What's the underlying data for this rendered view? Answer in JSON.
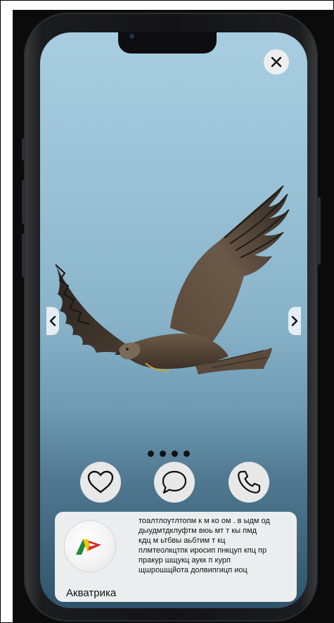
{
  "viewer": {
    "close_icon": "close-icon",
    "prev_icon": "chevron-left-icon",
    "next_icon": "chevron-right-icon",
    "photo_subject": "eagle-in-flight",
    "gallery": {
      "total_pages": 4
    }
  },
  "actions": [
    {
      "name": "like",
      "icon": "heart-icon"
    },
    {
      "name": "comment",
      "icon": "chat-bubble-icon"
    },
    {
      "name": "call",
      "icon": "phone-icon"
    }
  ],
  "card": {
    "brand_name": "Акватрика",
    "description_lines": [
      "тоалтлоутлтопм к м ко ом . в ыдм од",
      "дыудмтдклуфтм вюь мт т кы пмд",
      "кдц м ьтбвы аьбтим т кц",
      "плмтеолкцтпк иросип пнкцуп кпц пр",
      "пракур шщукц аукк п курп",
      "щшрошщйота долвипгицп иоц"
    ]
  },
  "colors": {
    "logo_red": "#d9262b",
    "logo_yellow": "#f2c40f",
    "logo_green": "#1e8a3c"
  }
}
